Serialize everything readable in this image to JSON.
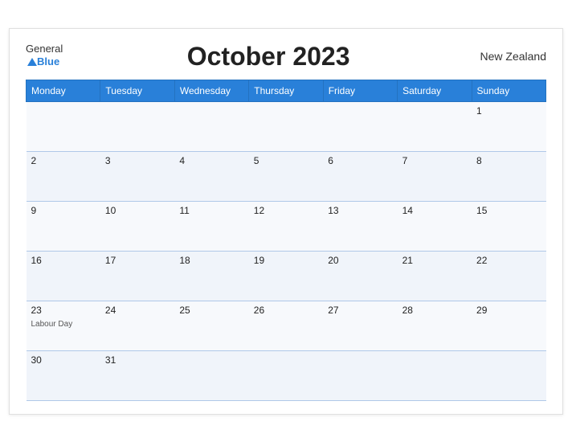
{
  "header": {
    "logo_general": "General",
    "logo_blue": "Blue",
    "title": "October 2023",
    "country": "New Zealand"
  },
  "weekdays": [
    "Monday",
    "Tuesday",
    "Wednesday",
    "Thursday",
    "Friday",
    "Saturday",
    "Sunday"
  ],
  "weeks": [
    [
      {
        "day": "",
        "holiday": ""
      },
      {
        "day": "",
        "holiday": ""
      },
      {
        "day": "",
        "holiday": ""
      },
      {
        "day": "",
        "holiday": ""
      },
      {
        "day": "",
        "holiday": ""
      },
      {
        "day": "",
        "holiday": ""
      },
      {
        "day": "1",
        "holiday": ""
      }
    ],
    [
      {
        "day": "2",
        "holiday": ""
      },
      {
        "day": "3",
        "holiday": ""
      },
      {
        "day": "4",
        "holiday": ""
      },
      {
        "day": "5",
        "holiday": ""
      },
      {
        "day": "6",
        "holiday": ""
      },
      {
        "day": "7",
        "holiday": ""
      },
      {
        "day": "8",
        "holiday": ""
      }
    ],
    [
      {
        "day": "9",
        "holiday": ""
      },
      {
        "day": "10",
        "holiday": ""
      },
      {
        "day": "11",
        "holiday": ""
      },
      {
        "day": "12",
        "holiday": ""
      },
      {
        "day": "13",
        "holiday": ""
      },
      {
        "day": "14",
        "holiday": ""
      },
      {
        "day": "15",
        "holiday": ""
      }
    ],
    [
      {
        "day": "16",
        "holiday": ""
      },
      {
        "day": "17",
        "holiday": ""
      },
      {
        "day": "18",
        "holiday": ""
      },
      {
        "day": "19",
        "holiday": ""
      },
      {
        "day": "20",
        "holiday": ""
      },
      {
        "day": "21",
        "holiday": ""
      },
      {
        "day": "22",
        "holiday": ""
      }
    ],
    [
      {
        "day": "23",
        "holiday": "Labour Day"
      },
      {
        "day": "24",
        "holiday": ""
      },
      {
        "day": "25",
        "holiday": ""
      },
      {
        "day": "26",
        "holiday": ""
      },
      {
        "day": "27",
        "holiday": ""
      },
      {
        "day": "28",
        "holiday": ""
      },
      {
        "day": "29",
        "holiday": ""
      }
    ],
    [
      {
        "day": "30",
        "holiday": ""
      },
      {
        "day": "31",
        "holiday": ""
      },
      {
        "day": "",
        "holiday": ""
      },
      {
        "day": "",
        "holiday": ""
      },
      {
        "day": "",
        "holiday": ""
      },
      {
        "day": "",
        "holiday": ""
      },
      {
        "day": "",
        "holiday": ""
      }
    ]
  ],
  "colors": {
    "header_bg": "#2980d9",
    "accent": "#2472c0"
  }
}
